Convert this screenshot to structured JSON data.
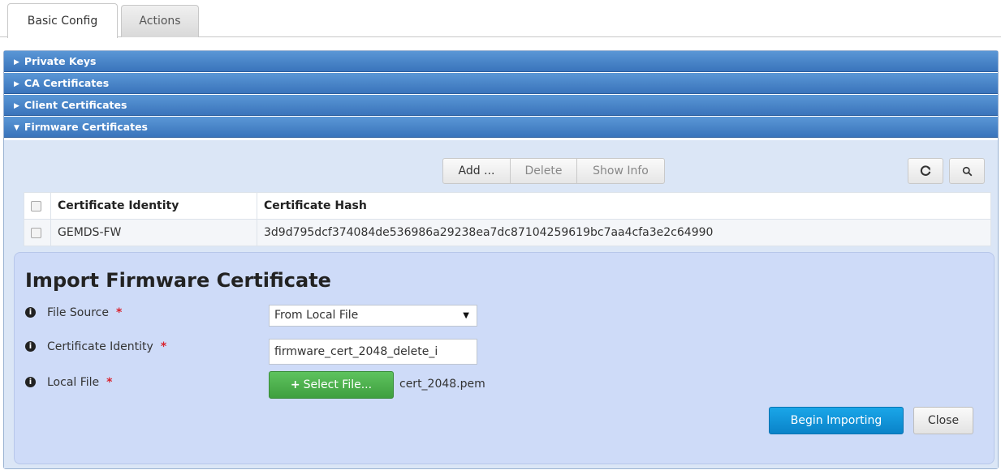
{
  "tabs": [
    {
      "label": "Basic Config",
      "active": true
    },
    {
      "label": "Actions",
      "active": false
    }
  ],
  "accordion": [
    {
      "label": "Private Keys",
      "expanded": false
    },
    {
      "label": "CA Certificates",
      "expanded": false
    },
    {
      "label": "Client Certificates",
      "expanded": false
    },
    {
      "label": "Firmware Certificates",
      "expanded": true
    }
  ],
  "toolbar": {
    "add_label": "Add ...",
    "delete_label": "Delete",
    "show_info_label": "Show Info",
    "refresh_icon": "refresh-icon",
    "search_icon": "search-icon"
  },
  "table": {
    "columns": [
      "Certificate Identity",
      "Certificate Hash"
    ],
    "rows": [
      {
        "identity": "GEMDS-FW",
        "hash": "3d9d795dcf374084de536986a29238ea7dc87104259619bc7aa4cfa3e2c64990"
      }
    ]
  },
  "import_form": {
    "title": "Import Firmware Certificate",
    "file_source_label": "File Source",
    "file_source_value": "From Local File",
    "identity_label": "Certificate Identity",
    "identity_value": "firmware_cert_2048_delete_i",
    "local_file_label": "Local File",
    "select_file_label": "Select File...",
    "selected_file": "cert_2048.pem",
    "required_marker": "*",
    "begin_label": "Begin Importing",
    "close_label": "Close"
  },
  "colors": {
    "accordion_header": "#3a74bb",
    "import_panel_bg": "#cedbf8",
    "select_file_button": "#3f9f3f",
    "begin_button": "#0a83c9",
    "required": "#d9232e"
  }
}
